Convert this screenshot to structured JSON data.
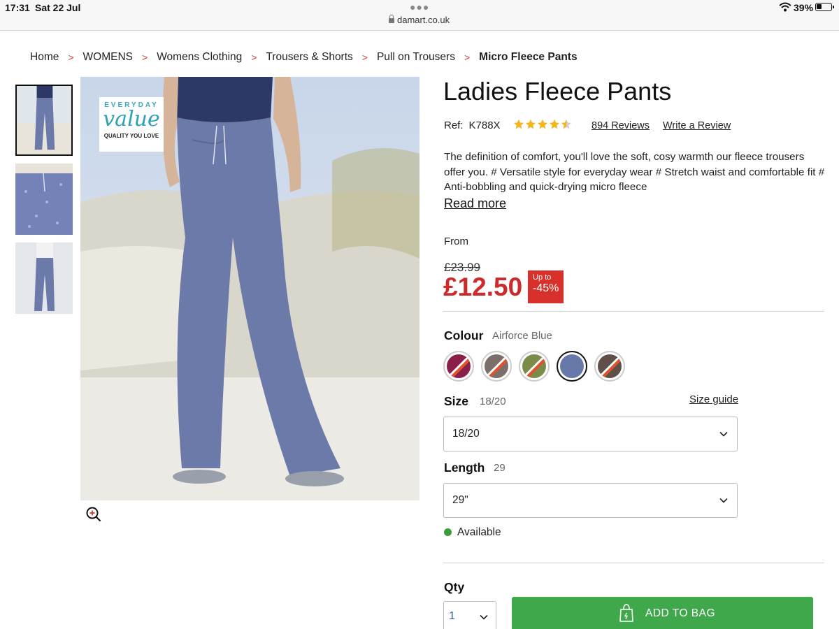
{
  "status_bar": {
    "time": "17:31",
    "date": "Sat 22 Jul",
    "url": "damart.co.uk",
    "battery_pct_label": "39%",
    "battery_level": 0.39
  },
  "breadcrumb": [
    {
      "label": "Home"
    },
    {
      "label": "WOMENS"
    },
    {
      "label": "Womens Clothing"
    },
    {
      "label": "Trousers & Shorts"
    },
    {
      "label": "Pull on Trousers"
    },
    {
      "label": "Micro Fleece Pants"
    }
  ],
  "breadcrumb_separator": ">",
  "gallery": {
    "badge_line1": "EVERYDAY",
    "badge_line2": "value",
    "badge_line3": "QUALITY YOU LOVE",
    "zoom_icon": "zoom-in-icon"
  },
  "product": {
    "title": "Ladies Fleece Pants",
    "ref_label": "Ref:",
    "ref_value": "K788X",
    "rating": 4.5,
    "rating_max": 5,
    "reviews_label": "894 Reviews",
    "write_review_label": "Write a Review",
    "description": "The definition of comfort, you'll love the soft, cosy warmth our fleece trousers offer you. # Versatile style for everyday wear # Stretch waist and comfortable fit # Anti-bobbling and quick-drying micro fleece",
    "read_more_label": "Read more"
  },
  "price": {
    "from_label": "From",
    "old_price": "£23.99",
    "new_price": "£12.50",
    "discount_line1": "Up to",
    "discount_line2": "-45%"
  },
  "colour": {
    "label": "Colour",
    "selected": "Airforce Blue",
    "swatches": [
      {
        "color": "#8a1f4a",
        "unavailable": true
      },
      {
        "color": "#7a6f6b",
        "unavailable": true
      },
      {
        "color": "#7a8c4a",
        "unavailable": true
      },
      {
        "color": "#6779a8",
        "unavailable": false
      },
      {
        "color": "#5e5048",
        "unavailable": true
      }
    ]
  },
  "size": {
    "label": "Size",
    "selected_label": "18/20",
    "size_guide_label": "Size guide",
    "dropdown_value": "18/20"
  },
  "length": {
    "label": "Length",
    "selected_label": "29",
    "dropdown_value": "29\""
  },
  "availability": {
    "text": "Available",
    "color": "#3a9d3a"
  },
  "qty": {
    "label": "Qty",
    "value": "1"
  },
  "add_to_bag": {
    "label": "ADD TO BAG",
    "color": "#3fa84a"
  },
  "colors": {
    "price_red": "#cc2b2b",
    "breadcrumb_separator": "#d23b2e",
    "badge_teal": "#2aa1b5"
  }
}
